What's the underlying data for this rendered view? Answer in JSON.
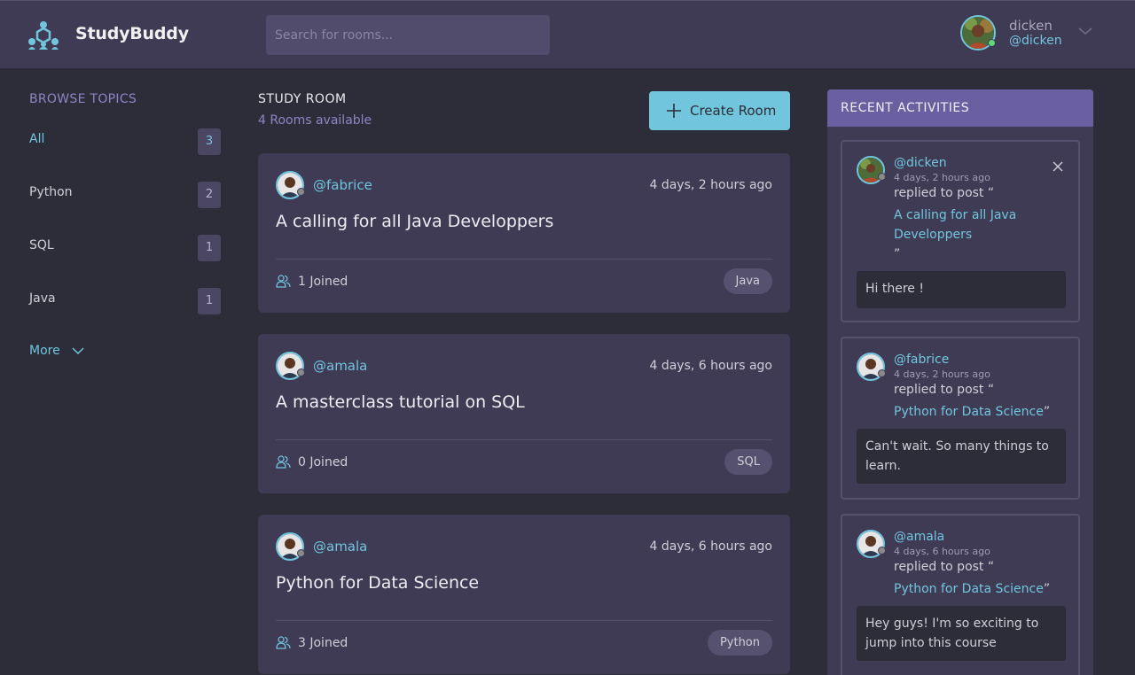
{
  "header": {
    "brand": "StudyBuddy",
    "search_placeholder": "Search for rooms...",
    "user": {
      "name": "dicken",
      "handle": "@dicken"
    }
  },
  "sidebar": {
    "title": "BROWSE TOPICS",
    "topics": [
      {
        "label": "All",
        "count": "3"
      },
      {
        "label": "Python",
        "count": "2"
      },
      {
        "label": "SQL",
        "count": "1"
      },
      {
        "label": "Java",
        "count": "1"
      }
    ],
    "more_label": "More"
  },
  "main": {
    "title": "STUDY ROOM",
    "subtitle": "4 Rooms available",
    "create_label": "Create Room",
    "rooms": [
      {
        "host": "@fabrice",
        "time": "4 days, 2 hours ago",
        "title": "A calling for all Java Developpers",
        "joined": "1 Joined",
        "topic": "Java"
      },
      {
        "host": "@amala",
        "time": "4 days, 6 hours ago",
        "title": "A masterclass tutorial on SQL",
        "joined": "0 Joined",
        "topic": "SQL"
      },
      {
        "host": "@amala",
        "time": "4 days, 6 hours ago",
        "title": "Python for Data Science",
        "joined": "3 Joined",
        "topic": "Python"
      }
    ]
  },
  "activities": {
    "title": "RECENT ACTIVITIES",
    "items": [
      {
        "user": "@dicken",
        "time": "4 days, 2 hours ago",
        "verb": "replied to post “",
        "post": "A calling for all Java Developpers",
        "close_quote": "”",
        "message": "Hi there !"
      },
      {
        "user": "@fabrice",
        "time": "4 days, 2 hours ago",
        "verb": "replied to post “",
        "post": "Python for Data Science",
        "close_quote": "”",
        "message": "Can't wait. So many things to learn."
      },
      {
        "user": "@amala",
        "time": "4 days, 6 hours ago",
        "verb": "replied to post “",
        "post": "Python for Data Science",
        "close_quote": "”",
        "message": "Hey guys! I'm so exciting to jump into this course"
      }
    ]
  },
  "colors": {
    "background": "#2d2d39",
    "surface": "#3f3b55",
    "accent": "#71c6dd",
    "purple": "#8f84c5",
    "activity_header": "#6a5fa0",
    "online": "#5dd97a",
    "offline": "#8a8a8a"
  },
  "icons": [
    "logo-icon",
    "chevron-down-icon",
    "plus-icon",
    "users-icon",
    "close-icon"
  ]
}
